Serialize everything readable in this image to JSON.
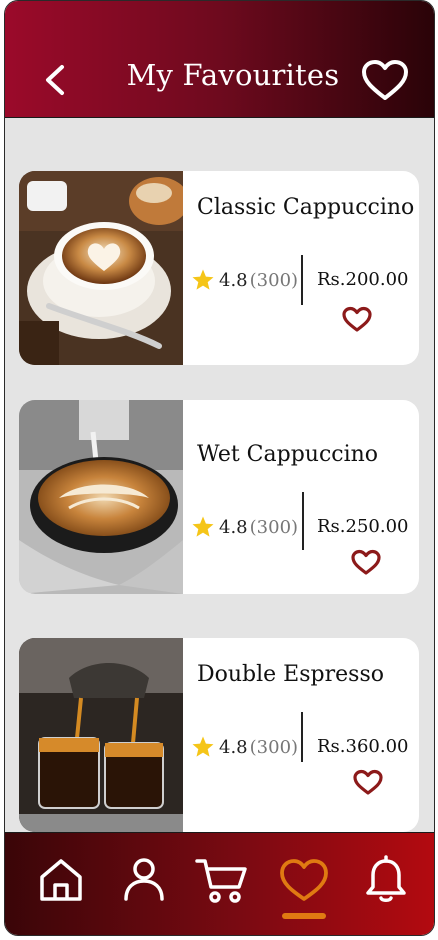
{
  "header": {
    "title": "My Favourites"
  },
  "colors": {
    "accent": "#9b0a2a",
    "active_tab": "#e07a12",
    "heart": "#8c1a1a",
    "star": "#f5c518"
  },
  "favourites": [
    {
      "name": "Classic Cappuccino",
      "rating": "4.8",
      "reviews": "(300)",
      "price": "Rs.200.00"
    },
    {
      "name": "Wet Cappuccino",
      "rating": "4.8",
      "reviews": "(300)",
      "price": "Rs.250.00"
    },
    {
      "name": "Double Espresso",
      "rating": "4.8",
      "reviews": "(300)",
      "price": "Rs.360.00"
    }
  ],
  "bottom_nav": {
    "items": [
      {
        "icon": "home-icon",
        "active": false
      },
      {
        "icon": "user-icon",
        "active": false
      },
      {
        "icon": "cart-icon",
        "active": false
      },
      {
        "icon": "heart-icon",
        "active": true
      },
      {
        "icon": "bell-icon",
        "active": false
      }
    ]
  }
}
